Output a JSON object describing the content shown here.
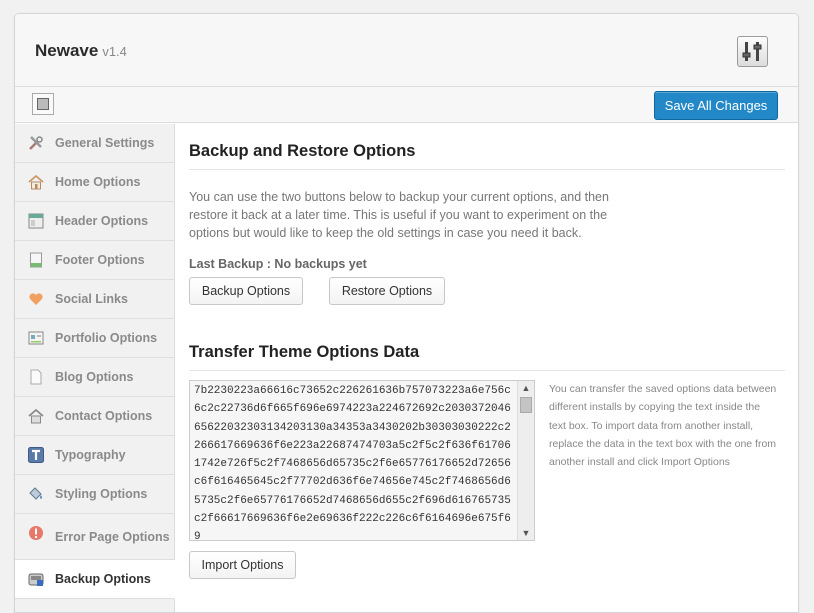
{
  "header": {
    "title": "Newave",
    "version": "v1.4"
  },
  "toolbar": {
    "save_label": "Save All Changes"
  },
  "sidebar": {
    "items": [
      {
        "label": "General Settings",
        "icon": "wrench-tools-icon",
        "active": false
      },
      {
        "label": "Home Options",
        "icon": "home-icon",
        "active": false
      },
      {
        "label": "Header Options",
        "icon": "header-layout-icon",
        "active": false
      },
      {
        "label": "Footer Options",
        "icon": "footer-page-icon",
        "active": false
      },
      {
        "label": "Social Links",
        "icon": "heart-icon",
        "active": false
      },
      {
        "label": "Portfolio Options",
        "icon": "portfolio-icon",
        "active": false
      },
      {
        "label": "Blog Options",
        "icon": "document-icon",
        "active": false
      },
      {
        "label": "Contact Options",
        "icon": "contact-home-icon",
        "active": false
      },
      {
        "label": "Typography",
        "icon": "typography-t-icon",
        "active": false
      },
      {
        "label": "Styling Options",
        "icon": "paint-bucket-icon",
        "active": false
      },
      {
        "label": "Error Page Options",
        "icon": "error-alert-icon",
        "active": false
      },
      {
        "label": "Backup Options",
        "icon": "backup-drive-icon",
        "active": true
      }
    ]
  },
  "backup": {
    "title": "Backup and Restore Options",
    "description": "You can use the two buttons below to backup your current options, and then restore it back at a later time. This is useful if you want to experiment on the options but would like to keep the old settings in case you need it back.",
    "last_backup": "Last Backup : No backups yet",
    "backup_button": "Backup Options",
    "restore_button": "Restore Options"
  },
  "transfer": {
    "title": "Transfer Theme Options Data",
    "data": "7b2230223a66616c73652c226261636b757073223a6e756c6c2c22736d6f665f696e6974223a224672692c203037204665622032303134203130a34353a3430202b30303030222c2266617669636f6e223a22687474703a5c2f5c2f636f617061742e726f5c2f7468656d65735c2f6e65776176652d72656c6f616465645c2f77702d636f6e74656e745c2f7468656d65735c2f6e65776176652d7468656d655c2f696d616765735c2f66617669636f6e2e69636f222c226c6f6164696e675f69",
    "help": "You can transfer the saved options data between different installs by copying the text inside the text box. To import data from another install, replace the data in the text box with the one from another install and click Import Options",
    "import_button": "Import Options"
  },
  "colors": {
    "accent": "#2388c8",
    "sidebar_bg": "#f1f1f1"
  }
}
